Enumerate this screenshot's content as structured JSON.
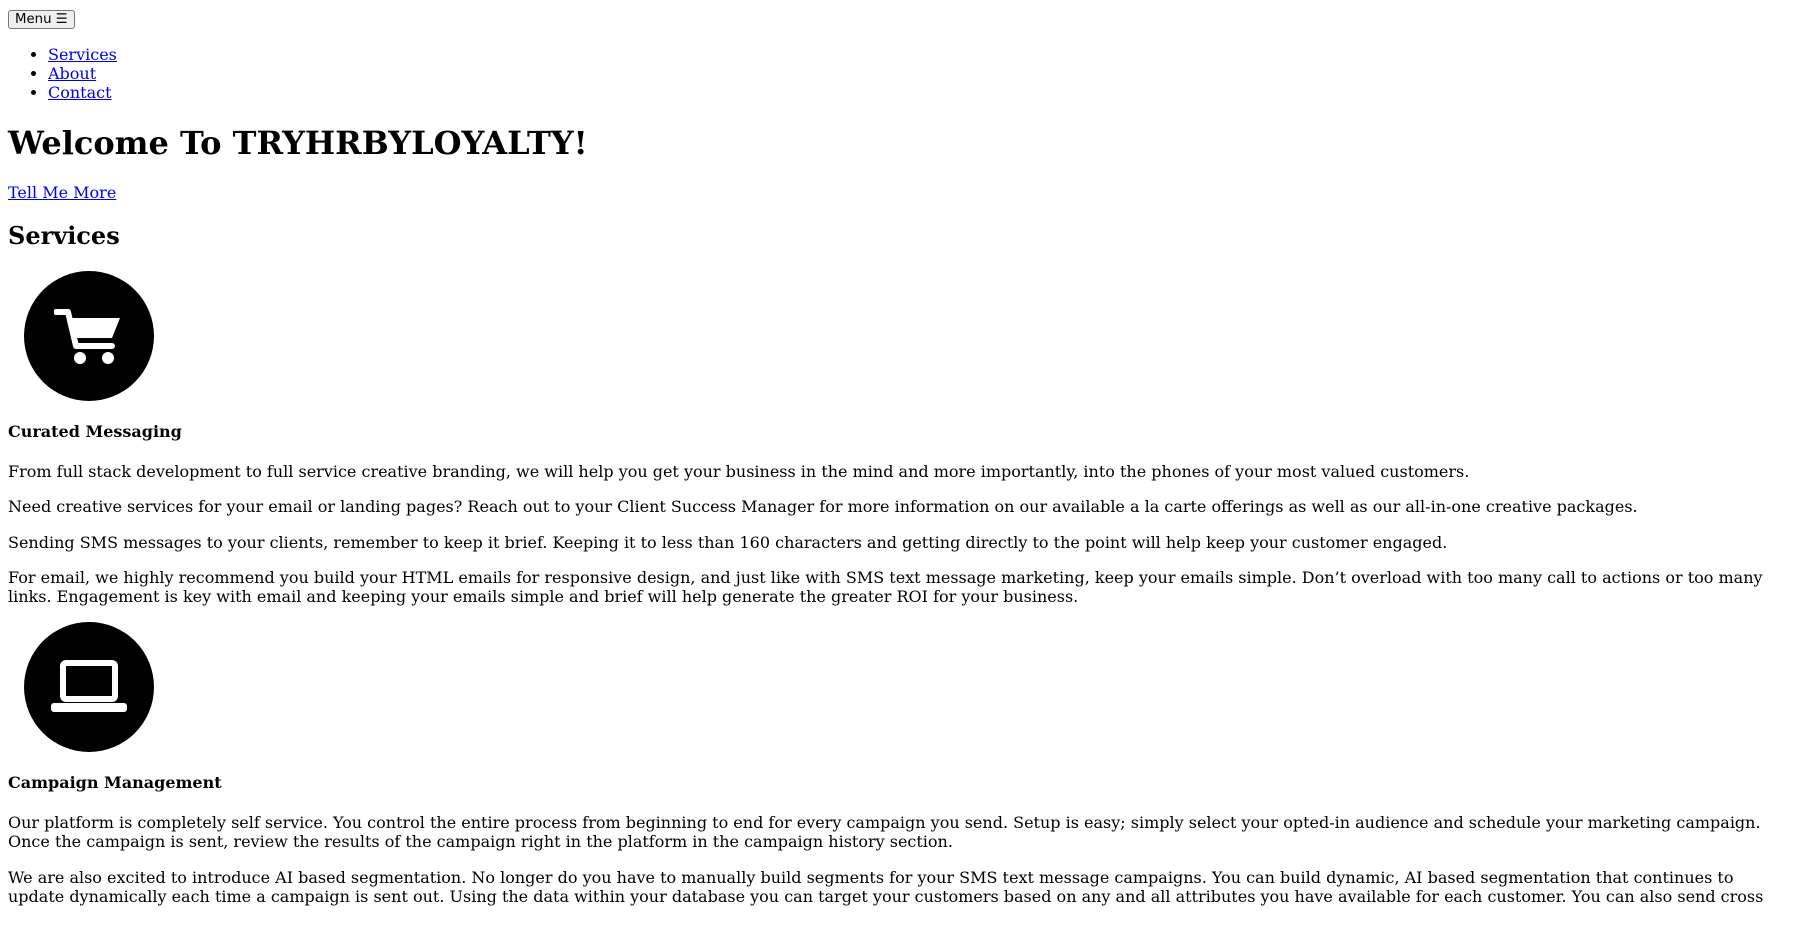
{
  "nav": {
    "menu_label": "Menu ☰",
    "links": [
      "Services",
      "About",
      "Contact"
    ]
  },
  "hero": {
    "title": "Welcome To TRYHRBYLOYALTY!",
    "cta": "Tell Me More"
  },
  "services": {
    "heading": "Services",
    "items": [
      {
        "icon": "shopping-cart-icon",
        "title": "Curated Messaging",
        "paragraphs": [
          "From full stack development to full service creative branding, we will help you get your business in the mind and more importantly, into the phones of your most valued customers.",
          "Need creative services for your email or landing pages? Reach out to your Client Success Manager for more information on our available a la carte offerings as well as our all-in-one creative packages.",
          "Sending SMS messages to your clients, remember to keep it brief. Keeping it to less than 160 characters and getting directly to the point will help keep your customer engaged.",
          "For email, we highly recommend you build your HTML emails for responsive design, and just like with SMS text message marketing, keep your emails simple. Don’t overload with too many call to actions or too many links. Engagement is key with email and keeping your emails simple and brief will help generate the greater ROI for your business."
        ]
      },
      {
        "icon": "laptop-icon",
        "title": "Campaign Management",
        "paragraphs": [
          "Our platform is completely self service. You control the entire process from beginning to end for every campaign you send. Setup is easy; simply select your opted-in audience and schedule your marketing campaign. Once the campaign is sent, review the results of the campaign right in the platform in the campaign history section.",
          "We are also excited to introduce AI based segmentation. No longer do you have to manually build segments for your SMS text message campaigns. You can build dynamic, AI based segmentation that continues to update dynamically each time a campaign is sent out. Using the data within your database you can target your customers based on any and all attributes you have available for each customer. You can also send cross"
        ]
      }
    ]
  }
}
